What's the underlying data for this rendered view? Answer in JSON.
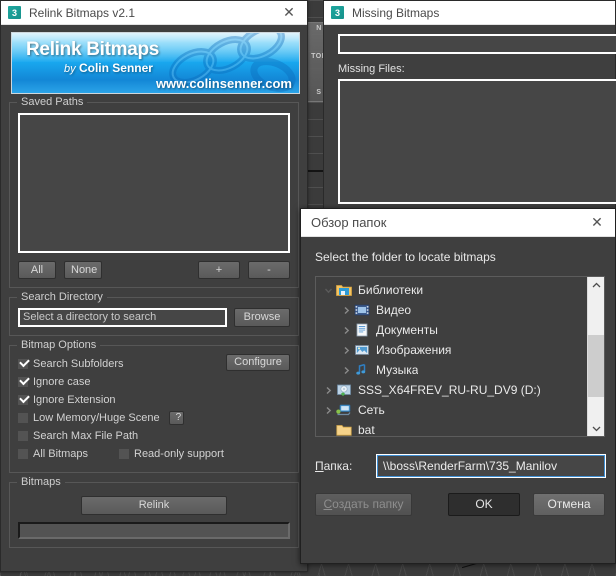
{
  "relink_window": {
    "title": "Relink Bitmaps v2.1",
    "icon": "max-3-icon",
    "close": "✕",
    "banner": {
      "title": "Relink Bitmaps",
      "by": "by",
      "author": "Colin Senner",
      "url": "www.colinsenner.com"
    },
    "saved_paths": {
      "legend": "Saved Paths",
      "all": "All",
      "none": "None",
      "add": "+",
      "remove": "-"
    },
    "search_directory": {
      "legend": "Search Directory",
      "placeholder": "Select a directory to search",
      "value": "Select a directory to search",
      "browse": "Browse"
    },
    "bitmap_options": {
      "legend": "Bitmap Options",
      "configure": "Configure",
      "help": "?",
      "items": [
        {
          "label": "Search Subfolders",
          "checked": true
        },
        {
          "label": "Ignore case",
          "checked": true
        },
        {
          "label": "Ignore Extension",
          "checked": true
        },
        {
          "label": "Low Memory/Huge Scene",
          "checked": false
        },
        {
          "label": "Search Max File Path",
          "checked": false
        },
        {
          "label": "All Bitmaps",
          "checked": false
        },
        {
          "label": "Read-only support",
          "checked": false
        }
      ]
    },
    "bitmaps": {
      "legend": "Bitmaps",
      "relink": "Relink",
      "progress_value": ""
    }
  },
  "missing_window": {
    "title": "Missing Bitmaps",
    "icon": "max-3-icon",
    "search_value": "",
    "missing_files_label": "Missing Files:",
    "list_items": []
  },
  "folder_dialog": {
    "title": "Обзор папок",
    "close": "✕",
    "prompt": "Select the folder to locate bitmaps",
    "tree": [
      {
        "label": "Библиотеки",
        "icon": "libraries-folder-icon",
        "expander": "chevron-down",
        "level": 1
      },
      {
        "label": "Видео",
        "icon": "video-library-icon",
        "expander": "chevron-right",
        "level": 2
      },
      {
        "label": "Документы",
        "icon": "documents-library-icon",
        "expander": "chevron-right",
        "level": 2
      },
      {
        "label": "Изображения",
        "icon": "pictures-library-icon",
        "expander": "chevron-right",
        "level": 2
      },
      {
        "label": "Музыка",
        "icon": "music-library-icon",
        "expander": "chevron-right",
        "level": 2
      },
      {
        "label": "SSS_X64FREV_RU-RU_DV9 (D:)",
        "icon": "dvd-drive-icon",
        "expander": "chevron-right",
        "level": 1
      },
      {
        "label": "Сеть",
        "icon": "network-icon",
        "expander": "chevron-right",
        "level": 1
      },
      {
        "label": "bat",
        "icon": "folder-icon",
        "expander": "",
        "level": 1
      }
    ],
    "path_label": "Папка:",
    "path_label_mnemonic": "П",
    "path_label_rest": "апка:",
    "path_value": "\\\\boss\\RenderFarm\\735_Manilov",
    "new_folder_button": "Создать папку",
    "new_folder_mnemonic": "С",
    "new_folder_rest": "оздать папку",
    "ok_button": "OK",
    "cancel_button": "Отмена"
  },
  "viewport": {
    "viewcube_north": "N",
    "viewcube_top": "TOP",
    "viewcube_south": "S"
  },
  "colors": {
    "dialog_bg": "#3f3f3f",
    "banner_blue": "#19a8ef",
    "accent_focus": "#3f8fd4",
    "max_icon": "#1fa8a0"
  }
}
